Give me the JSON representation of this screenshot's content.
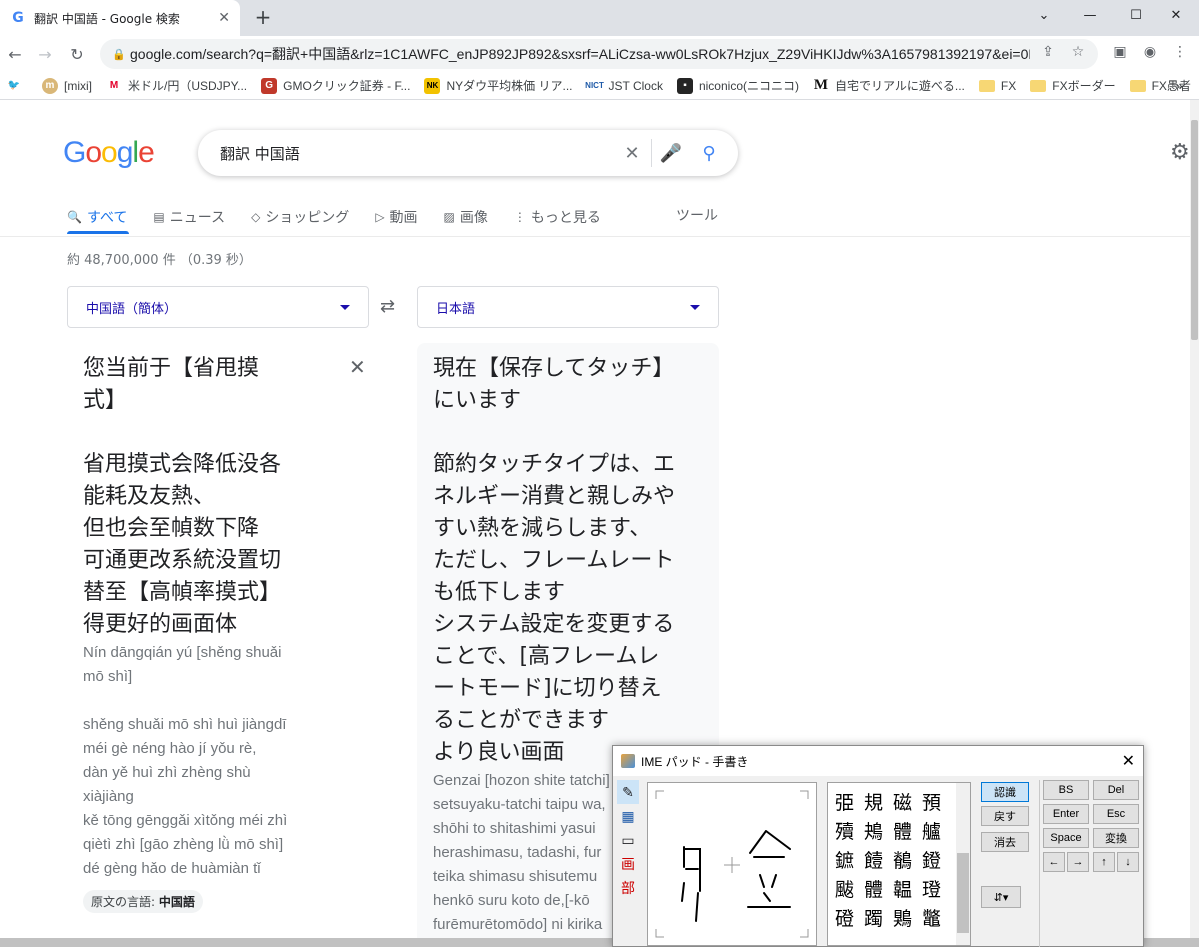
{
  "browser": {
    "tab_title": "翻訳 中国語 - Google 検索",
    "url": "google.com/search?q=翻訳+中国語&rlz=1C1AWFC_enJP892JP892&sxsrf=ALiCzsa-ww0LsROk7Hzjux_Z29ViHKIJdw%3A1657981392197&ei=0M...",
    "new_tab": "+",
    "window": {
      "minimize": "—",
      "maximize": "☐",
      "close": "✕"
    }
  },
  "bookmarks": [
    {
      "label": "",
      "icon": "twitter-icon",
      "glyph": "🐦",
      "color": "#1da1f2"
    },
    {
      "label": "[mixi]",
      "icon": "mixi-icon",
      "glyph": "m",
      "color": "#c8a86b"
    },
    {
      "label": "米ドル/円（USDJPY...",
      "icon": "m-icon",
      "glyph": "M",
      "color": "#e4002b"
    },
    {
      "label": "GMOクリック証券 - F...",
      "icon": "gmo-icon",
      "glyph": "G",
      "color": "#c0392b"
    },
    {
      "label": "NYダウ平均株価 リア...",
      "icon": "nk-icon",
      "glyph": "NK",
      "color": "#f2c200"
    },
    {
      "label": "JST Clock",
      "icon": "nict-icon",
      "glyph": "N",
      "color": "#1e5aa8"
    },
    {
      "label": "niconico(ニコニコ)",
      "icon": "niconico-icon",
      "glyph": "▣",
      "color": "#252525"
    },
    {
      "label": "自宅でリアルに遊べる...",
      "icon": "m-bold-icon",
      "glyph": "M",
      "color": "#111111"
    },
    {
      "label": "FX",
      "icon": "folder-icon",
      "glyph": "",
      "color": "#f7d774"
    },
    {
      "label": "FXボーダー",
      "icon": "folder-icon",
      "glyph": "",
      "color": "#f7d774"
    },
    {
      "label": "FX愚者",
      "icon": "folder-icon",
      "glyph": "",
      "color": "#f7d774"
    }
  ],
  "bookmarks_more": "»",
  "google": {
    "logo": [
      "G",
      "o",
      "o",
      "g",
      "l",
      "e"
    ],
    "query": "翻訳 中国語",
    "tabs": [
      {
        "label": "すべて",
        "icon": "🔍",
        "active": true
      },
      {
        "label": "ニュース",
        "icon": "▤",
        "active": false
      },
      {
        "label": "ショッピング",
        "icon": "◇",
        "active": false
      },
      {
        "label": "動画",
        "icon": "▷",
        "active": false
      },
      {
        "label": "画像",
        "icon": "▨",
        "active": false
      },
      {
        "label": "もっと見る",
        "icon": "⋮",
        "active": false
      }
    ],
    "tools": "ツール",
    "stats": "約 48,700,000 件 （0.39 秒）"
  },
  "translate": {
    "source_lang": "中国語（簡体）",
    "target_lang": "日本語",
    "source_text": "您当前于【省甩摸\n式】\n\n省甩摸式会降低没各\n能耗及友熱、\n但也会至幀数下降\n可通更改系統没置切\n替至【高幀率摸式】\n得更好的画面体",
    "source_pinyin": "Nín dāngqián yú [shěng shuǎi\nmō shì]\n\nshěng shuǎi mō shì huì jiàngdī\nméi gè néng hào jí yǒu rè,\ndàn yě huì zhì zhèng shù\nxiàjiàng\nkě tōng gēnggǎi xìtǒng méi zhì\nqiètì zhì [gāo zhèng lǜ mō shì]\ndé gèng hǎo de huàmiàn tǐ",
    "source_lang_chip_label": "原文の言語: ",
    "source_lang_chip_value": "中国語",
    "target_text": "現在【保存してタッチ】\nにいます\n\n節約タッチタイプは、エ\nネルギー消費と親しみや\nすい熱を減らします、\nただし、フレームレート\nも低下します\nシステム設定を変更する\nことで、[高フレームレ\nートモード]に切り替え\nることができます\nより良い画面",
    "target_romaji": "Genzai [hozon shite tatchi]\nsetsuyaku-tatchi taipu wa,\nshōhi to shitashimi yasui\nherashimasu, tadashi, fur\nteika shimasu shisutemu\nhenkō suru koto de,[-kō\nfurēmurētomōdo] ni kirika"
  },
  "ime": {
    "title": "IME パッド - 手書き",
    "side_labels": [
      "✎",
      "▦",
      "▭",
      "画",
      "部"
    ],
    "candidates": [
      "弫",
      "規",
      "磁",
      "預",
      "殰",
      "鴂",
      "體",
      "艫",
      "鏣",
      "饐",
      "鶺",
      "鐙",
      "颰",
      "體",
      "韞",
      "璒",
      "磴",
      "躅",
      "鶪",
      "鼈"
    ],
    "buttons": {
      "recognize": "認識",
      "undo": "戻す",
      "clear": "消去"
    },
    "keys": [
      "BS",
      "Del",
      "Enter",
      "Esc",
      "Space",
      "変換"
    ],
    "arrows": [
      "←",
      "→",
      "↑",
      "↓"
    ]
  }
}
